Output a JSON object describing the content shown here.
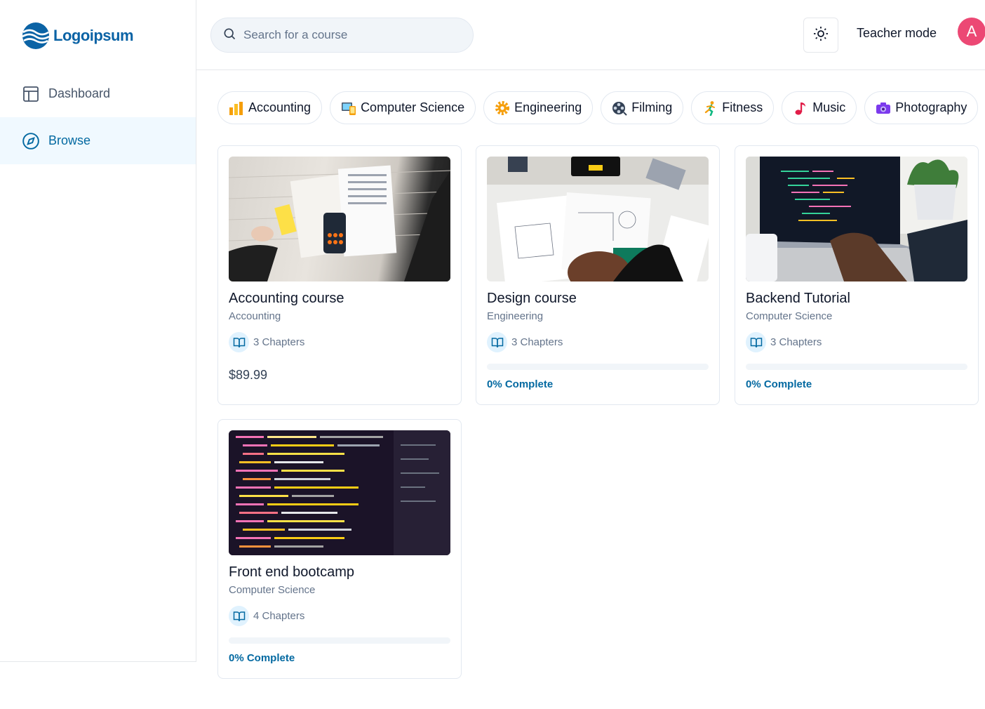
{
  "brand": {
    "name": "Logoipsum",
    "color": "#0b63a5"
  },
  "sidebar": {
    "items": [
      {
        "label": "Dashboard",
        "icon": "layout-icon",
        "active": false
      },
      {
        "label": "Browse",
        "icon": "compass-icon",
        "active": true
      }
    ]
  },
  "header": {
    "search_placeholder": "Search for a course",
    "theme_icon": "sun-icon",
    "teacher_mode_label": "Teacher mode",
    "avatar_letter": "A",
    "avatar_color": "#ec4874"
  },
  "categories": [
    {
      "label": "Accounting",
      "icon": "bar-chart-icon"
    },
    {
      "label": "Computer Science",
      "icon": "computer-icon"
    },
    {
      "label": "Engineering",
      "icon": "gear-icon"
    },
    {
      "label": "Filming",
      "icon": "film-reel-icon"
    },
    {
      "label": "Fitness",
      "icon": "runner-icon"
    },
    {
      "label": "Music",
      "icon": "music-note-icon"
    },
    {
      "label": "Photography",
      "icon": "camera-icon"
    }
  ],
  "courses": [
    {
      "title": "Accounting course",
      "category": "Accounting",
      "chapters": "3 Chapters",
      "price": "$89.99",
      "progress": null,
      "progress_label": ""
    },
    {
      "title": "Design course",
      "category": "Engineering",
      "chapters": "3 Chapters",
      "price": "",
      "progress": 0,
      "progress_label": "0% Complete"
    },
    {
      "title": "Backend Tutorial",
      "category": "Computer Science",
      "chapters": "3 Chapters",
      "price": "",
      "progress": 0,
      "progress_label": "0% Complete"
    },
    {
      "title": "Front end bootcamp",
      "category": "Computer Science",
      "chapters": "4 Chapters",
      "price": "",
      "progress": 0,
      "progress_label": "0% Complete"
    }
  ],
  "colors": {
    "accent": "#0369a1",
    "active_bg": "#f0f9ff",
    "border": "#e2e8f0"
  }
}
